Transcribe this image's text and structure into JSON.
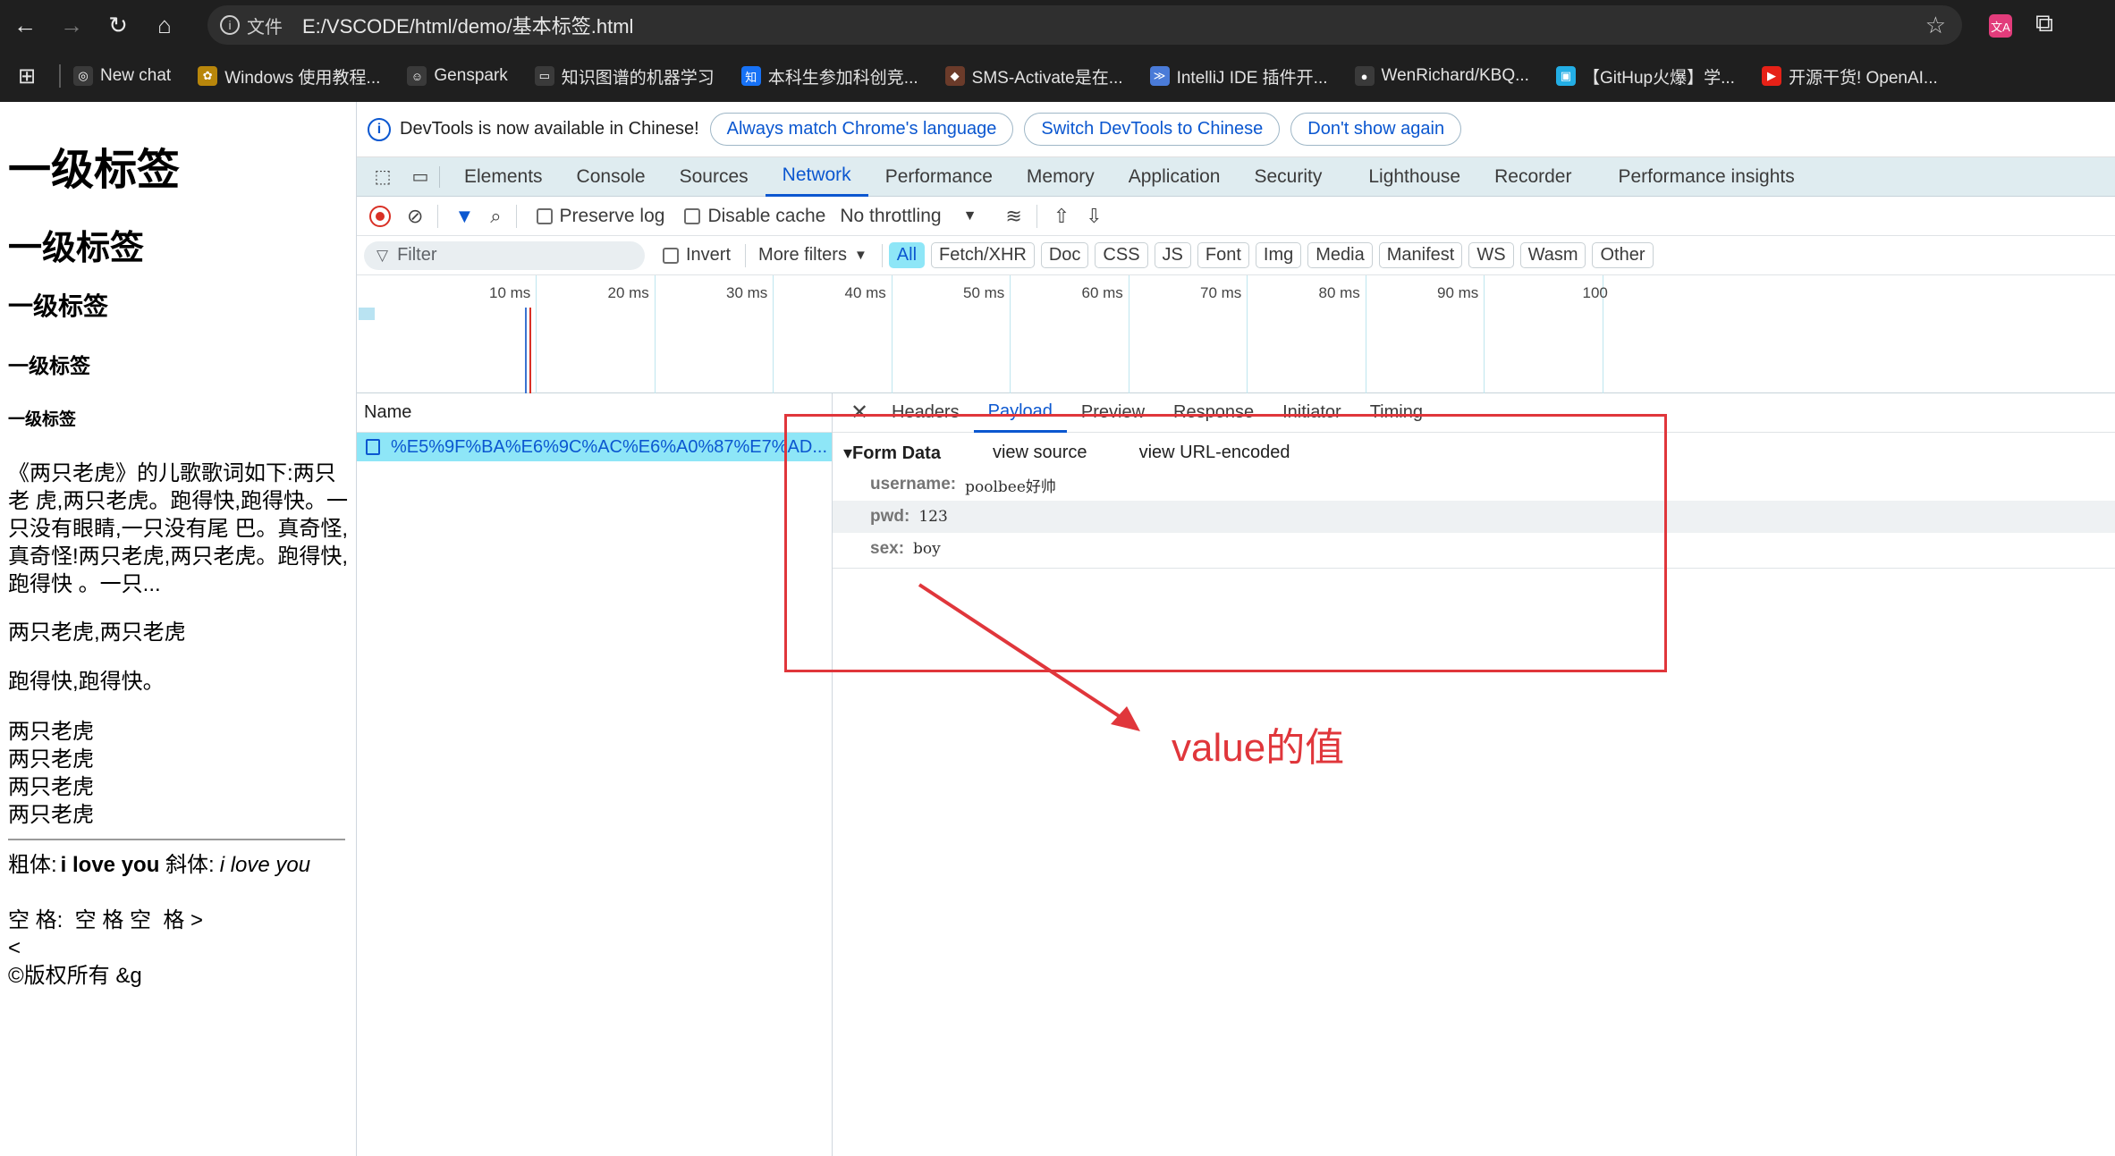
{
  "browser": {
    "omnibox": {
      "file_label": "文件",
      "url": "E:/VSCODE/html/demo/基本标签.html"
    },
    "bookmarks": [
      {
        "label": "New chat",
        "icon": "openai-icon",
        "color": "#3a3a3a"
      },
      {
        "label": "Windows 使用教程...",
        "icon": "bee-icon",
        "color": "#b8860b"
      },
      {
        "label": "Genspark",
        "icon": "genspark-icon",
        "color": "#3a3a3a"
      },
      {
        "label": "知识图谱的机器学习",
        "icon": "folder-icon",
        "color": "#3a3a3a"
      },
      {
        "label": "本科生参加科创竞...",
        "icon": "zhihu-icon",
        "color": "#1772f6"
      },
      {
        "label": "SMS-Activate是在...",
        "icon": "bird-icon",
        "color": "#6b3b2a"
      },
      {
        "label": "IntelliJ IDE 插件开...",
        "icon": "chevron-icon",
        "color": "#4a7bd8"
      },
      {
        "label": "WenRichard/KBQ...",
        "icon": "github-icon",
        "color": "#3a3a3a"
      },
      {
        "label": "【GitHup火爆】学...",
        "icon": "bilibili-icon",
        "color": "#23aee5"
      },
      {
        "label": "开源干货! OpenAI...",
        "icon": "youtube-icon",
        "color": "#e62117"
      }
    ]
  },
  "page": {
    "h1": "一级标签",
    "h2": "一级标签",
    "h3": "一级标签",
    "h4": "一级标签",
    "h5": "一级标签",
    "para1": "《两只老虎》的儿歌歌词如下:两只老 虎,两只老虎。跑得快,跑得快。一只没有眼睛,一只没有尾 巴。真奇怪,真奇怪!两只老虎,两只老虎。跑得快,跑得快 。一只...",
    "para2": "两只老虎,两只老虎",
    "para3": "跑得快,跑得快。",
    "lines": [
      "两只老虎",
      "两只老虎",
      "两只老虎",
      "两只老虎"
    ],
    "bold_label": "粗体:",
    "bold_text": "i love you",
    "italic_label": "斜体:",
    "italic_text": "i love you",
    "space_line": "空 格:  空 格 空  格 >",
    "lt_line": "<",
    "copy_line": "©版权所有 &g"
  },
  "devtools": {
    "infobar": {
      "message": "DevTools is now available in Chinese!",
      "btn_match": "Always match Chrome's language",
      "btn_switch": "Switch DevTools to Chinese",
      "btn_dont": "Don't show again"
    },
    "tabs": [
      "Elements",
      "Console",
      "Sources",
      "Network",
      "Performance",
      "Memory",
      "Application",
      "Security",
      "Lighthouse",
      "Recorder",
      "Performance insights"
    ],
    "active_tab": "Network",
    "toolbar": {
      "preserve_log": "Preserve log",
      "disable_cache": "Disable cache",
      "throttling": "No throttling"
    },
    "filter": {
      "placeholder": "Filter",
      "invert": "Invert",
      "more_filters": "More filters",
      "chips": [
        "All",
        "Fetch/XHR",
        "Doc",
        "CSS",
        "JS",
        "Font",
        "Img",
        "Media",
        "Manifest",
        "WS",
        "Wasm",
        "Other"
      ]
    },
    "timeline": {
      "labels": [
        "10 ms",
        "20 ms",
        "30 ms",
        "40 ms",
        "50 ms",
        "60 ms",
        "70 ms",
        "80 ms",
        "90 ms",
        "100"
      ]
    },
    "requests": {
      "header": "Name",
      "rows": [
        "%E5%9F%BA%E6%9C%AC%E6%A0%87%E7%AD..."
      ]
    },
    "detail": {
      "tabs": [
        "Headers",
        "Payload",
        "Preview",
        "Response",
        "Initiator",
        "Timing"
      ],
      "active": "Payload",
      "form_title": "▾Form Data",
      "view_source": "view source",
      "view_url": "view URL-encoded",
      "fields": [
        {
          "key": "username:",
          "value": "poolbee好帅"
        },
        {
          "key": "pwd:",
          "value": "123"
        },
        {
          "key": "sex:",
          "value": "boy"
        }
      ]
    },
    "annotation": {
      "text": "value的值",
      "color": "#e0363b"
    }
  }
}
